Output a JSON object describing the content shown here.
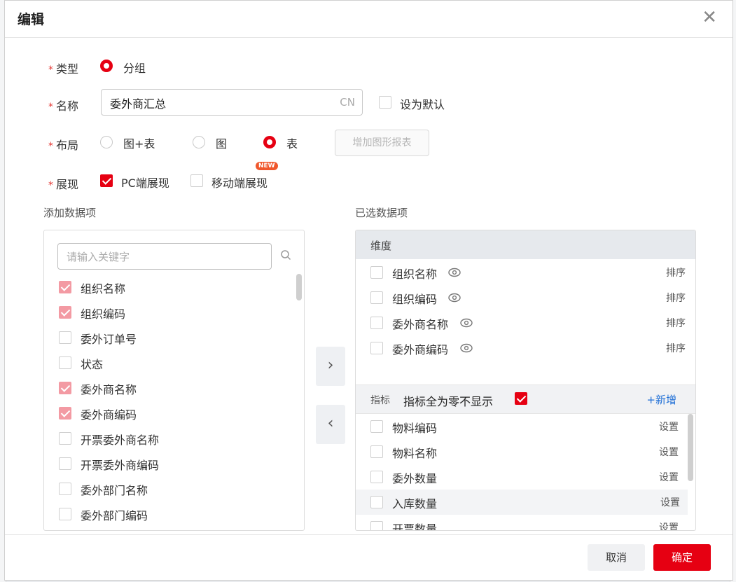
{
  "dialog": {
    "title": "编辑"
  },
  "form": {
    "type": {
      "label": "类型",
      "option": "分组"
    },
    "name": {
      "label": "名称",
      "value": "委外商汇总",
      "lang_tag": "CN",
      "default_label": "设为默认"
    },
    "layout": {
      "label": "布局",
      "options": [
        "图+表",
        "图",
        "表"
      ],
      "selected": "表",
      "add_chart_button": "增加图形报表"
    },
    "display": {
      "label": "展现",
      "pc_label": "PC端展现",
      "pc_checked": true,
      "mobile_label": "移动端展现",
      "mobile_checked": false,
      "new_badge": "NEW"
    }
  },
  "available": {
    "title": "添加数据项",
    "search_placeholder": "请输入关键字",
    "items": [
      {
        "label": "组织名称",
        "checked": true
      },
      {
        "label": "组织编码",
        "checked": true
      },
      {
        "label": "委外订单号",
        "checked": false
      },
      {
        "label": "状态",
        "checked": false
      },
      {
        "label": "委外商名称",
        "checked": true
      },
      {
        "label": "委外商编码",
        "checked": true
      },
      {
        "label": "开票委外商名称",
        "checked": false
      },
      {
        "label": "开票委外商编码",
        "checked": false
      },
      {
        "label": "委外部门名称",
        "checked": false
      },
      {
        "label": "委外部门编码",
        "checked": false
      }
    ]
  },
  "selected": {
    "title": "已选数据项",
    "dimension_header": "维度",
    "dimensions": [
      {
        "label": "组织名称",
        "action": "排序"
      },
      {
        "label": "组织编码",
        "action": "排序"
      },
      {
        "label": "委外商名称",
        "action": "排序"
      },
      {
        "label": "委外商编码",
        "action": "排序"
      }
    ],
    "metric_header": "指标",
    "hide_zero_label": "指标全为零不显示",
    "hide_zero_checked": true,
    "add_label": "+新增",
    "metrics": [
      {
        "label": "物料编码",
        "action": "设置"
      },
      {
        "label": "物料名称",
        "action": "设置"
      },
      {
        "label": "委外数量",
        "action": "设置"
      },
      {
        "label": "入库数量",
        "action": "设置"
      },
      {
        "label": "开票数量",
        "action": "设置"
      }
    ]
  },
  "transfer": {
    "right_arrow": "›",
    "left_arrow": "‹"
  },
  "footer": {
    "cancel": "取消",
    "confirm": "确定"
  },
  "colors": {
    "accent": "#e60012",
    "link": "#1f6fd6"
  }
}
